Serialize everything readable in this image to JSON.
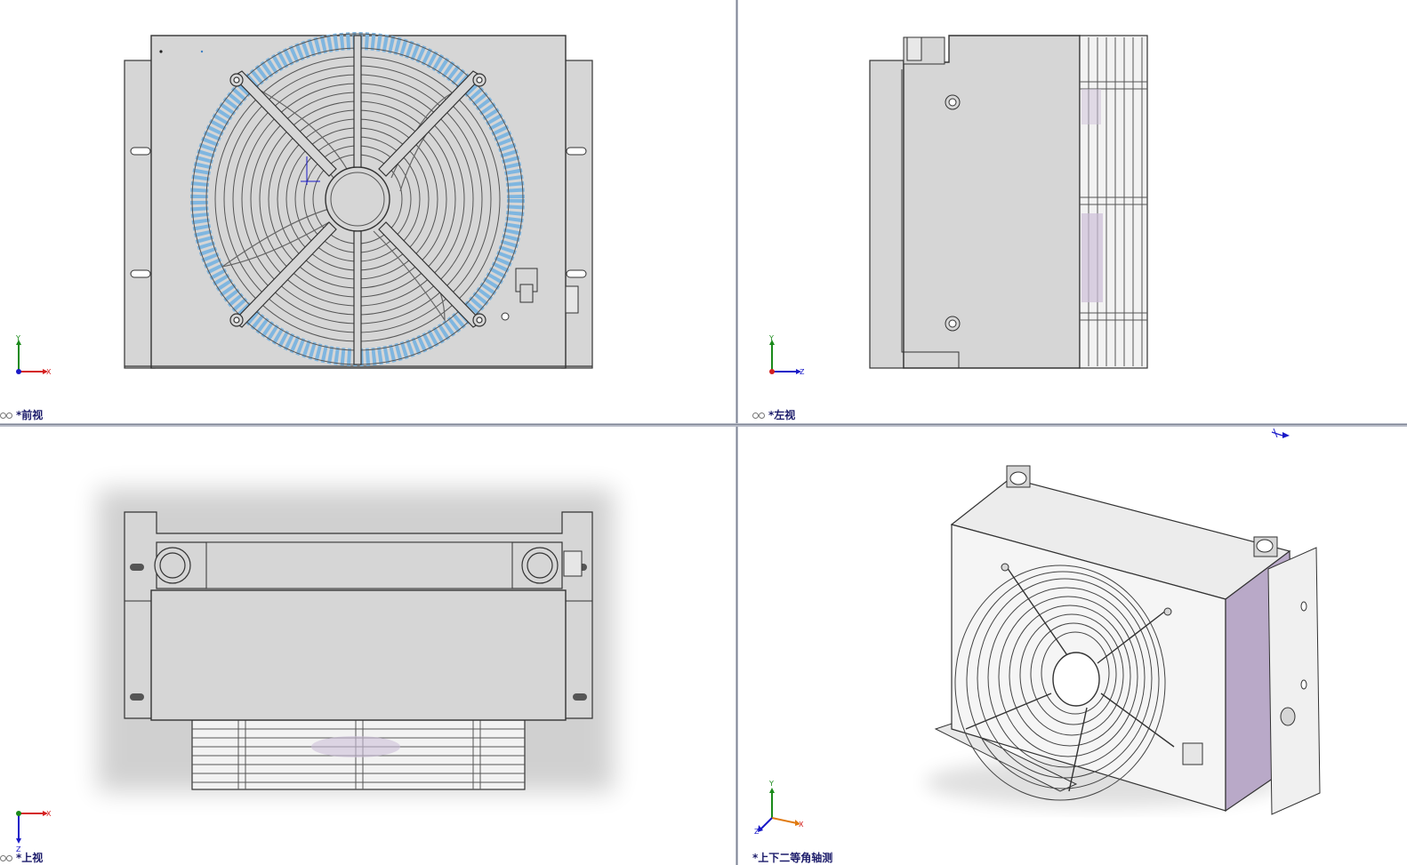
{
  "viewports": {
    "front": {
      "label": "*前视",
      "axes": [
        "Y",
        "X"
      ]
    },
    "left": {
      "label": "*左视",
      "axes": [
        "Y",
        "Z"
      ]
    },
    "top": {
      "label": "*上视",
      "axes": [
        "X",
        "Z"
      ]
    },
    "iso": {
      "label": "*上下二等角轴测",
      "axes": [
        "Y",
        "X",
        "Z"
      ]
    }
  },
  "icons": {
    "view_state": "glasses-icon",
    "triad": "coordinate-triad-icon",
    "origin": "origin-marker-icon"
  },
  "colors": {
    "background": "#ffffff",
    "divider": "#b8bcc8",
    "part_fill": "#d6d6d6",
    "part_edge": "#333333",
    "core_blue": "#7fb6e0",
    "shade_purple": "#b9a9c8",
    "axis_x": "#d42020",
    "axis_y": "#1a8a1a",
    "axis_z": "#1a1ac8",
    "label_text": "#1b1b6a"
  }
}
